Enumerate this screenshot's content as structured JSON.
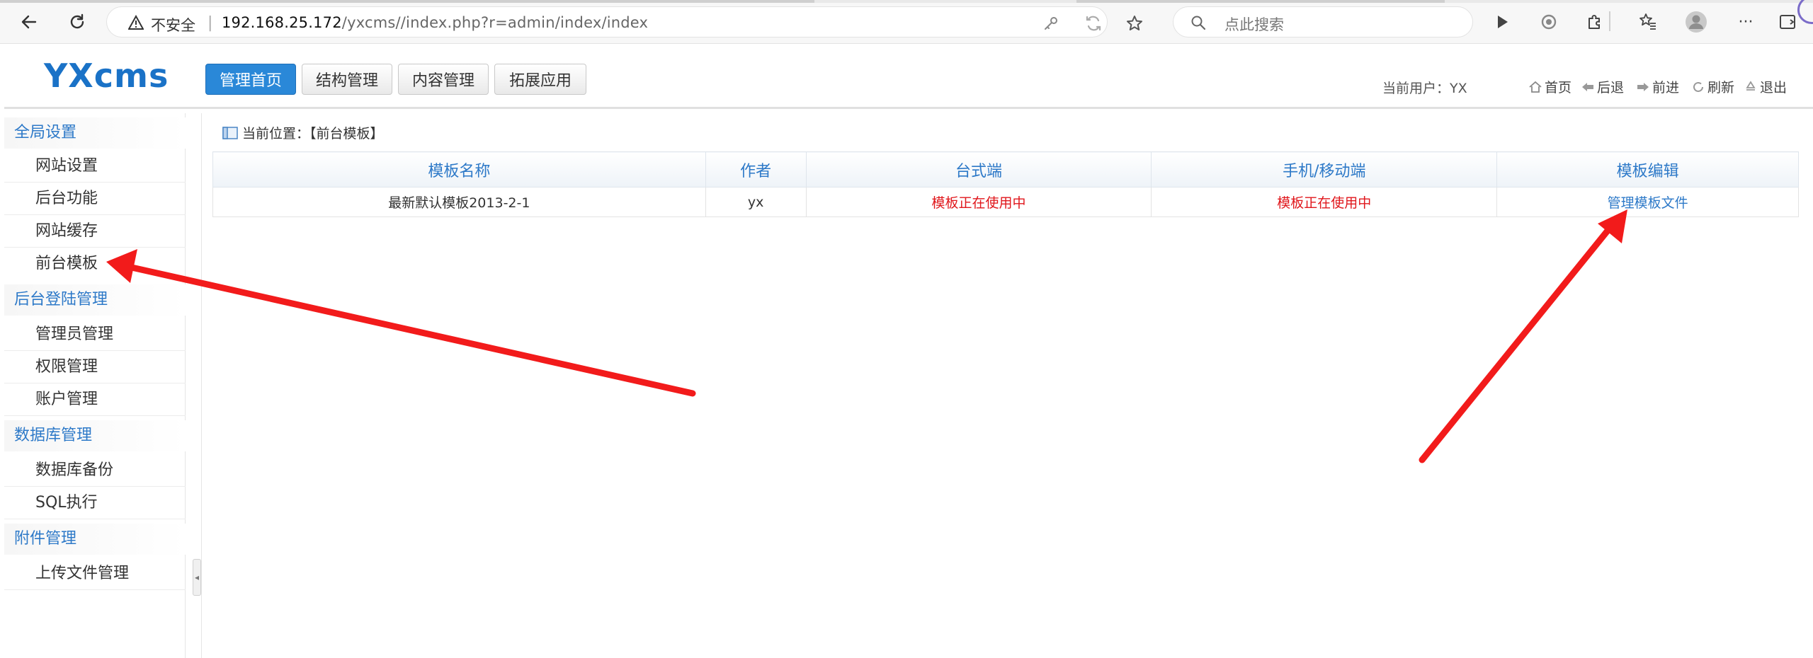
{
  "browser": {
    "insecure_label": "不安全",
    "url_host": "192.168.25.172",
    "url_path": "/yxcms//index.php?r=admin/index/index",
    "search_placeholder": "点此搜索"
  },
  "header": {
    "logo": "YXcms",
    "menu": [
      {
        "label": "管理首页",
        "active": true
      },
      {
        "label": "结构管理",
        "active": false
      },
      {
        "label": "内容管理",
        "active": false
      },
      {
        "label": "拓展应用",
        "active": false
      }
    ],
    "current_user": "当前用户：YX",
    "links": [
      "首页",
      "后退",
      "前进",
      "刷新",
      "退出"
    ]
  },
  "sidebar": {
    "groups": [
      {
        "label": "全局设置",
        "items": [
          "网站设置",
          "后台功能",
          "网站缓存",
          "前台模板"
        ]
      },
      {
        "label": "后台登陆管理",
        "items": [
          "管理员管理",
          "权限管理",
          "账户管理"
        ]
      },
      {
        "label": "数据库管理",
        "items": [
          "数据库备份",
          "SQL执行"
        ]
      },
      {
        "label": "附件管理",
        "items": [
          "上传文件管理"
        ]
      }
    ]
  },
  "main": {
    "breadcrumb": "当前位置：【前台模板】",
    "table": {
      "headers": [
        "模板名称",
        "作者",
        "台式端",
        "手机/移动端",
        "模板编辑"
      ],
      "rows": [
        [
          "最新默认模板2013-2-1",
          "yx",
          "模板正在使用中",
          "模板正在使用中",
          "管理模板文件"
        ]
      ]
    }
  },
  "colors": {
    "accent": "#2a88d8",
    "link": "#2d79c8",
    "status_red": "#e0161b",
    "annotation_arrow": "#f21b1b"
  }
}
